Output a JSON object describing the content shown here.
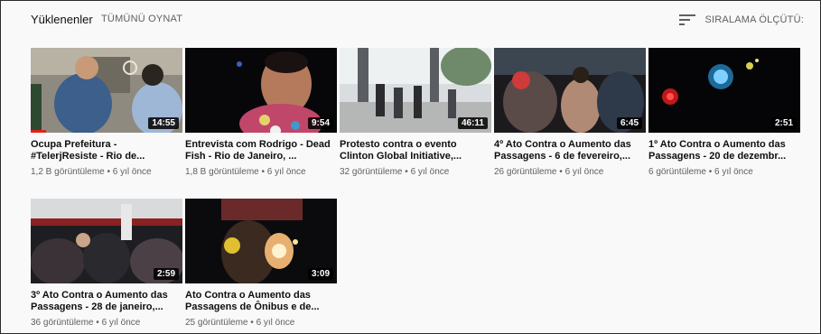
{
  "header": {
    "title": "Yüklenenler",
    "play_all": "TÜMÜNÜ OYNAT",
    "sort_label": "SIRALAMA ÖLÇÜTÜ:",
    "sort_icon": "sort-icon"
  },
  "colors": {
    "progress": "#e62117",
    "meta_text": "#606060",
    "title_text": "#0f0f0f"
  },
  "videos": [
    {
      "title": "Ocupa Prefeitura - #TelerjResiste - Rio de...",
      "duration": "14:55",
      "views": "1,2 B görüntüleme",
      "age": "6 yıl önce",
      "watched_fraction": 0.1
    },
    {
      "title": "Entrevista com Rodrigo - Dead Fish - Rio de Janeiro, ...",
      "duration": "9:54",
      "views": "1,8 B görüntüleme",
      "age": "6 yıl önce"
    },
    {
      "title": "Protesto contra o evento Clinton Global Initiative,...",
      "duration": "46:11",
      "views": "32 görüntüleme",
      "age": "6 yıl önce"
    },
    {
      "title": "4º Ato Contra o Aumento das Passagens - 6 de fevereiro,...",
      "duration": "6:45",
      "views": "26 görüntüleme",
      "age": "6 yıl önce"
    },
    {
      "title": "1º Ato Contra o Aumento das Passagens - 20 de dezembr...",
      "duration": "2:51",
      "views": "6 görüntüleme",
      "age": "6 yıl önce"
    },
    {
      "title": "3º Ato Contra o Aumento das Passagens - 28 de janeiro,...",
      "duration": "2:59",
      "views": "36 görüntüleme",
      "age": "6 yıl önce"
    },
    {
      "title": "Ato Contra o Aumento das Passagens de Ônibus e de...",
      "duration": "3:09",
      "views": "25 görüntüleme",
      "age": "6 yıl önce"
    }
  ]
}
